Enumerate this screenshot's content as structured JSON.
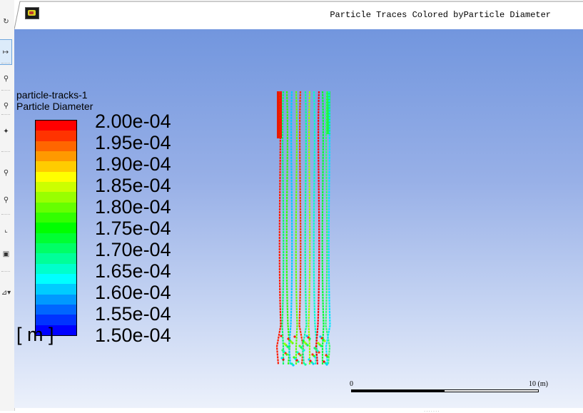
{
  "window": {
    "title": "Particle Traces Colored byParticle Diameter"
  },
  "toolbar": {
    "tools": [
      {
        "name": "rotate-tool",
        "glyph": "↻",
        "active": false
      },
      {
        "name": "pan-tool",
        "glyph": "↦",
        "active": true
      },
      {
        "name": "zoom-tool",
        "glyph": "⚲",
        "active": false
      },
      {
        "name": "zoom-box-tool",
        "glyph": "⚲",
        "active": false
      },
      {
        "name": "probe-tool",
        "glyph": "✦",
        "active": false
      },
      {
        "name": "zoom-in-tool",
        "glyph": "⚲",
        "active": false
      },
      {
        "name": "zoom-out-tool",
        "glyph": "⚲",
        "active": false
      },
      {
        "name": "view-tool",
        "glyph": "⌞",
        "active": false
      },
      {
        "name": "render-tool",
        "glyph": "▣",
        "active": false
      },
      {
        "name": "more-tools",
        "glyph": "⊿▾",
        "active": false
      }
    ]
  },
  "legend": {
    "title_line1": "particle-tracks-1",
    "title_line2": "Particle Diameter",
    "unit": "[ m ]",
    "ticks": [
      "2.00e-04",
      "1.95e-04",
      "1.90e-04",
      "1.85e-04",
      "1.80e-04",
      "1.75e-04",
      "1.70e-04",
      "1.65e-04",
      "1.60e-04",
      "1.55e-04",
      "1.50e-04"
    ],
    "bands": [
      "#ff0000",
      "#ff3300",
      "#ff6600",
      "#ff9900",
      "#ffcc00",
      "#ffff00",
      "#ccff00",
      "#99ff00",
      "#66ff00",
      "#33ff00",
      "#00ff00",
      "#00ff33",
      "#00ff66",
      "#00ff99",
      "#00ffcc",
      "#00ffff",
      "#00ccff",
      "#0099ff",
      "#0066ff",
      "#0033ff",
      "#0000ff"
    ]
  },
  "scale_bar": {
    "min_label": "0",
    "max_label": "10 (m)"
  },
  "trace_colors": [
    "#ff1a00",
    "#00ff66",
    "#33ff00",
    "#00ccff",
    "#66ff00",
    "#ff3300",
    "#00ff99",
    "#99ff00",
    "#00ffcc",
    "#ff0000",
    "#00ff33",
    "#33ff66",
    "#00e5ff"
  ]
}
